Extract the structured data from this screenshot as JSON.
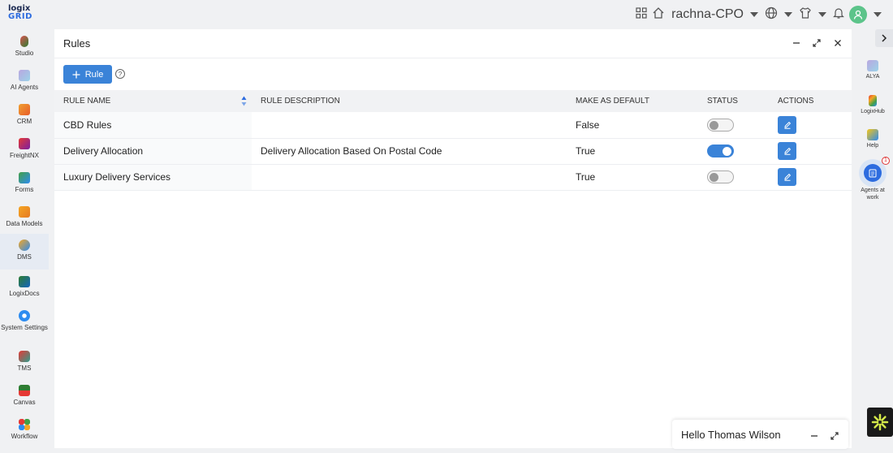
{
  "app": {
    "logo_line1": "logix",
    "logo_line2": "GRID"
  },
  "topbar": {
    "user_name": "rachna-CPO",
    "icons": [
      "grid-apps-icon",
      "home-icon",
      "globe-icon",
      "shirt-icon",
      "bell-icon",
      "avatar"
    ]
  },
  "leftnav": {
    "items": [
      {
        "label": "Studio",
        "icon": "studio-icon",
        "color": "#d9534f"
      },
      {
        "label": "AI Agents",
        "icon": "ai-agents-icon",
        "color": "#9bb7e8"
      },
      {
        "label": "CRM",
        "icon": "crm-icon",
        "color": "#f0a030"
      },
      {
        "label": "FreightNX",
        "icon": "freightnx-icon",
        "color": "#e53935"
      },
      {
        "label": "Forms",
        "icon": "forms-icon",
        "color": "#43a047"
      },
      {
        "label": "Data Models",
        "icon": "data-models-icon",
        "color": "#f39c12"
      },
      {
        "label": "DMS",
        "icon": "dms-icon",
        "color": "#f5a623"
      },
      {
        "label": "LogixDocs",
        "icon": "logixdocs-icon",
        "color": "#2e7d32"
      },
      {
        "label": "System Settings",
        "icon": "system-settings-icon",
        "color": "#2d8cf0"
      },
      {
        "label": "TMS",
        "icon": "tms-icon",
        "color": "#e53935"
      },
      {
        "label": "Canvas",
        "icon": "canvas-icon",
        "color": "#2e7d32"
      },
      {
        "label": "Workflow",
        "icon": "workflow-icon",
        "color": "#e53935"
      }
    ],
    "active": "DMS"
  },
  "panel": {
    "title": "Rules",
    "add_button_label": "Rule",
    "columns": [
      "RULE NAME",
      "RULE DESCRIPTION",
      "MAKE AS DEFAULT",
      "STATUS",
      "ACTIONS"
    ],
    "rows": [
      {
        "name": "CBD Rules",
        "description": "",
        "default": "False",
        "status_on": false
      },
      {
        "name": "Delivery Allocation",
        "description": "Delivery Allocation Based On Postal Code",
        "default": "True",
        "status_on": true
      },
      {
        "name": "Luxury Delivery Services",
        "description": "",
        "default": "True",
        "status_on": false
      }
    ]
  },
  "rightrail": {
    "items": [
      {
        "label": "ALYA",
        "icon": "alya-icon",
        "color": "#9bb7e8"
      },
      {
        "label": "LogixHub",
        "icon": "logixhub-icon",
        "color": "#e53935"
      },
      {
        "label": "Help",
        "icon": "help-icon",
        "color": "#f5c518"
      },
      {
        "label": "Agents at work",
        "icon": "agents-at-work-icon",
        "color": "#2d6cdf"
      }
    ],
    "agents_badge": "1"
  },
  "chat": {
    "greeting": "Hello Thomas Wilson"
  },
  "colors": {
    "accent": "#3a83d8",
    "background": "#f0f1f3"
  }
}
